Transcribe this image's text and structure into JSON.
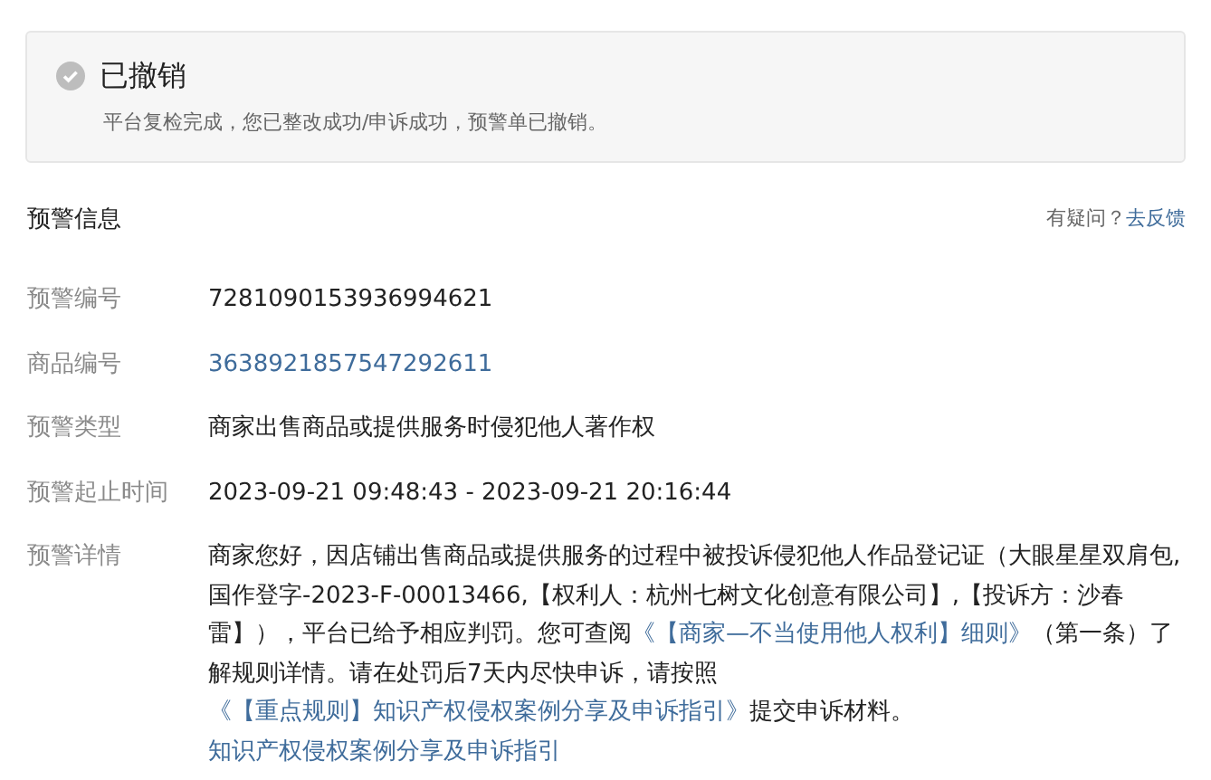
{
  "status": {
    "title": "已撤销",
    "description": "平台复检完成，您已整改成功/申诉成功，预警单已撤销。"
  },
  "section": {
    "title": "预警信息",
    "help_text": "有疑问？",
    "help_link": "去反馈"
  },
  "fields": [
    {
      "label": "预警编号",
      "kind": "text",
      "value": "7281090153936994621"
    },
    {
      "label": "商品编号",
      "kind": "link",
      "value": "3638921857547292611"
    },
    {
      "label": "预警类型",
      "kind": "text",
      "value": "商家出售商品或提供服务时侵犯他人著作权"
    },
    {
      "label": "预警起止时间",
      "kind": "text",
      "value": "2023-09-21 09:48:43 - 2023-09-21 20:16:44"
    },
    {
      "label": "预警详情",
      "kind": "rich",
      "segments": [
        {
          "kind": "text",
          "text": "商家您好，因店铺出售商品或提供服务的过程中被投诉侵犯他人作品登记证（大眼星星双肩包,国作登字-2023-F-00013466,【权利人：杭州七树文化创意有限公司】,【投诉方：沙春雷】），平台已给予相应判罚。您可查阅"
        },
        {
          "kind": "link",
          "text": "《【商家—不当使用他人权利】细则》"
        },
        {
          "kind": "text",
          "text": "（第一条）了解规则详情。请在处罚后7天内尽快申诉，请按照"
        },
        {
          "kind": "link",
          "text": "《【重点规则】知识产权侵权案例分享及申诉指引》"
        },
        {
          "kind": "text",
          "text": "提交申诉材料。"
        }
      ],
      "extra_link": "知识产权侵权案例分享及申诉指引"
    }
  ]
}
